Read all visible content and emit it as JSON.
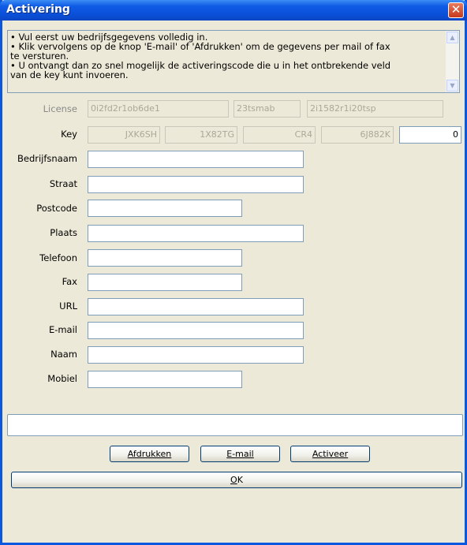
{
  "window": {
    "title": "Activering",
    "close_glyph": "✕"
  },
  "info": {
    "lines": [
      "• Vul eerst uw bedrijfsgegevens volledig in.",
      "• Klik vervolgens op de knop 'E-mail' of 'Afdrukken' om de gegevens per mail of fax",
      "   te versturen.",
      "• U ontvangt dan zo snel mogelijk de activeringscode die u in het ontbrekende veld",
      "   van de key kunt invoeren."
    ]
  },
  "license": {
    "label": "License",
    "values": [
      "0i2fd2r1ob6de1",
      "23tsmab",
      "2i1582r1i20tsp"
    ]
  },
  "key": {
    "label": "Key",
    "values": [
      "JXK6SH",
      "1X82TG",
      "CR4",
      "6J882K"
    ],
    "input_value": "0"
  },
  "form": {
    "bedrijfsnaam": "Bedrijfsnaam",
    "straat": "Straat",
    "postcode": "Postcode",
    "plaats": "Plaats",
    "telefoon": "Telefoon",
    "fax": "Fax",
    "url": "URL",
    "email": "E-mail",
    "naam": "Naam",
    "mobiel": "Mobiel"
  },
  "buttons": {
    "afdrukken": "Afdrukken",
    "email": "E-mail",
    "activeer": "Activeer",
    "ok_underlined": "O",
    "ok_rest": "K"
  }
}
